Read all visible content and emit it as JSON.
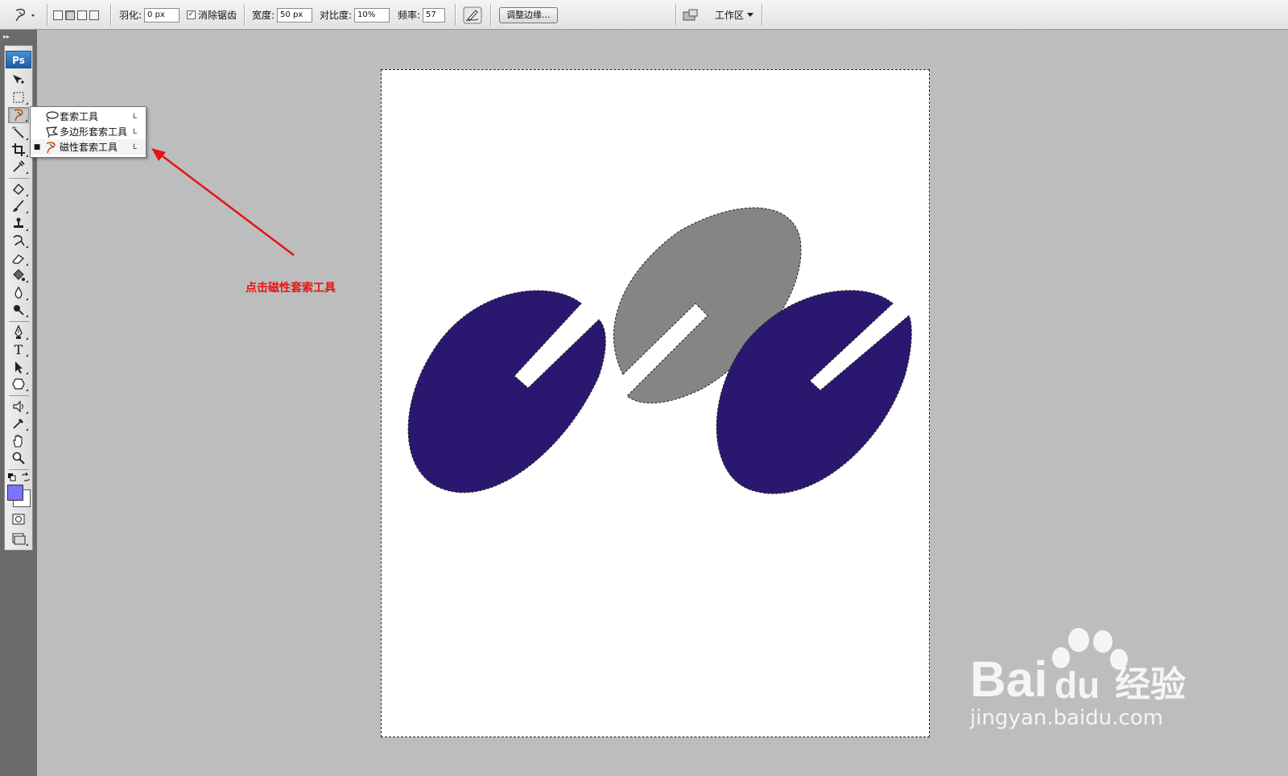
{
  "options_bar": {
    "feather_label": "羽化:",
    "feather_value": "0 px",
    "antialias_check": "✓",
    "antialias_label": "消除锯齿",
    "width_label": "宽度:",
    "width_value": "50 px",
    "contrast_label": "对比度:",
    "contrast_value": "10%",
    "frequency_label": "频率:",
    "frequency_value": "57",
    "refine_edge_label": "调整边缘...",
    "workspace_label": "工作区"
  },
  "toolbox": {
    "logo": "Ps",
    "type_tool_glyph": "T"
  },
  "flyout": {
    "items": [
      {
        "label": "套索工具",
        "shortcut": "L",
        "selected": false
      },
      {
        "label": "多边形套索工具",
        "shortcut": "L",
        "selected": false
      },
      {
        "label": "磁性套索工具",
        "shortcut": "L",
        "selected": true,
        "bullet": "■"
      }
    ]
  },
  "annotation": {
    "text": "点击磁性套索工具"
  },
  "colors": {
    "foreground": "#7b74ff",
    "background": "#ffffff",
    "shape_dark": "#2a1870",
    "shape_gray": "#858585",
    "annotation": "#e31414"
  },
  "watermark": {
    "brand": "Bai",
    "brand2": "du",
    "suffix": "经验",
    "url": "jingyan.baidu.com"
  }
}
